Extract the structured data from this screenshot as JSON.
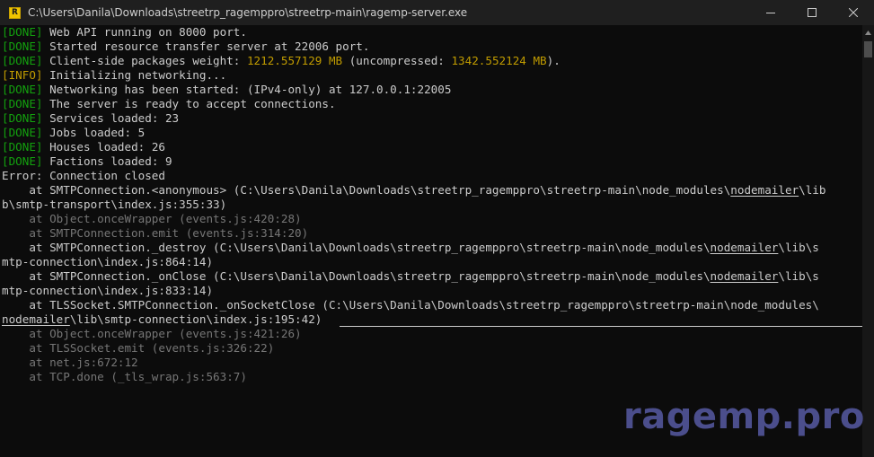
{
  "window": {
    "title": "C:\\Users\\Danila\\Downloads\\streetrp_ragemppro\\streetrp-main\\ragemp-server.exe",
    "app_icon_glyph": "R",
    "controls": [
      "minimize-icon",
      "maximize-icon",
      "close-icon"
    ]
  },
  "console": {
    "lines": [
      {
        "tag": "[DONE]",
        "text": " Web API running on 8000 port."
      },
      {
        "tag": "[DONE]",
        "text": " Started resource transfer server at 22006 port."
      },
      {
        "tag": "[DONE]",
        "text_a": " Client-side packages weight: ",
        "value_a": "1212.557129 MB",
        "text_b": " (uncompressed: ",
        "value_b": "1342.552124 MB",
        "text_c": ")."
      },
      {
        "tag": "[INFO]",
        "text": " Initializing networking..."
      },
      {
        "tag": "[DONE]",
        "text": " Networking has been started: (IPv4-only) at 127.0.0.1:22005"
      },
      {
        "tag": "[DONE]",
        "text": " The server is ready to accept connections."
      },
      {
        "tag": "[DONE]",
        "text": " Services loaded: 23"
      },
      {
        "tag": "[DONE]",
        "text": " Jobs loaded: 5"
      },
      {
        "tag": "[DONE]",
        "text": " Houses loaded: 26"
      },
      {
        "tag": "[DONE]",
        "text": " Factions loaded: 9"
      }
    ],
    "error": {
      "header": "Error: Connection closed",
      "stack": [
        {
          "a": "    at SMTPConnection.<anonymous> (C:\\Users\\Danila\\Downloads\\streetrp_ragemppro\\streetrp-main\\node_modules\\",
          "u": "nodemailer",
          "b": "\\lib"
        },
        {
          "a": "b\\smtp-transport\\index.js:355:33)"
        },
        {
          "gray": "    at Object.onceWrapper (events.js:420:28)"
        },
        {
          "gray": "    at SMTPConnection.emit (events.js:314:20)"
        },
        {
          "a": "    at SMTPConnection._destroy (C:\\Users\\Danila\\Downloads\\streetrp_ragemppro\\streetrp-main\\node_modules\\",
          "u": "nodemailer",
          "b": "\\lib\\s"
        },
        {
          "a": "mtp-connection\\index.js:864:14)"
        },
        {
          "a": "    at SMTPConnection._onClose (C:\\Users\\Danila\\Downloads\\streetrp_ragemppro\\streetrp-main\\node_modules\\",
          "u": "nodemailer",
          "b": "\\lib\\s"
        },
        {
          "a": "mtp-connection\\index.js:833:14)"
        },
        {
          "a": "    at TLSSocket.SMTPConnection._onSocketClose (C:\\Users\\Danila\\Downloads\\streetrp_ragemppro\\streetrp-main\\node_modules\\"
        },
        {
          "u": "nodemailer",
          "b": "\\lib\\smtp-connection\\index.js:195:42)"
        },
        {
          "gray": "    at Object.onceWrapper (events.js:421:26)"
        },
        {
          "gray": "    at TLSSocket.emit (events.js:326:22)"
        },
        {
          "gray": "    at net.js:672:12"
        },
        {
          "gray": "    at TCP.done (_tls_wrap.js:563:7)"
        }
      ]
    }
  },
  "watermark": "ragemp.pro",
  "colors": {
    "background": "#0c0c0c",
    "titlebar": "#1f1f1f",
    "done_green": "#13a10e",
    "info_yellow": "#c19c00",
    "text": "#cccccc",
    "gray_text": "#767676",
    "watermark": "#4b4e8c"
  }
}
